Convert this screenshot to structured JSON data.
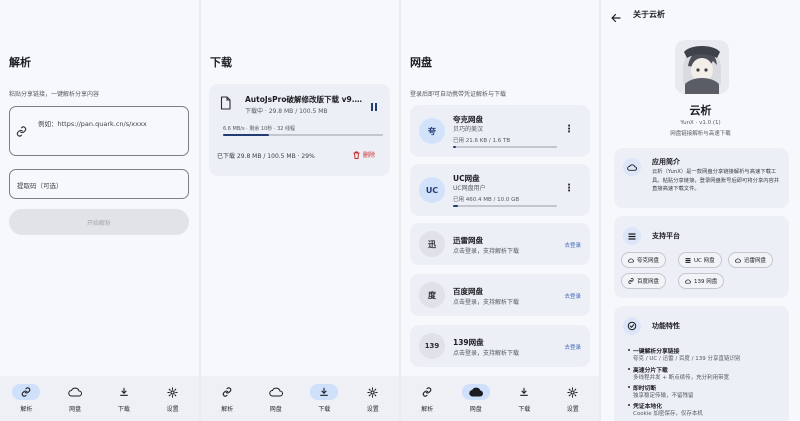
{
  "colors": {
    "accent": "#4269b8",
    "nav_active": "#cfe0fb",
    "delete": "#c62b2b",
    "card": "#eceff6"
  },
  "nav": {
    "items": [
      {
        "label": "解析",
        "icon": "link-icon"
      },
      {
        "label": "网盘",
        "icon": "cloud-icon"
      },
      {
        "label": "下载",
        "icon": "download-icon"
      },
      {
        "label": "设置",
        "icon": "gear-icon"
      }
    ]
  },
  "parse": {
    "title": "解析",
    "hint": "粘贴分享链接，一键解析分享内容",
    "link_placeholder": "例如：https://pan.quark.cn/s/xxxx",
    "code_placeholder": "提取码（可选）",
    "start_button": "开始解析"
  },
  "download": {
    "title": "下载",
    "task": {
      "name": "AutoJsPro破解修改版下载 v9.…",
      "status": "下载中 · 29.8 MB / 100.5 MB",
      "speed": "6.6 MB/s · 剩余 10秒 · 32 线程",
      "progress": 0.29,
      "downloaded": "已下载 29.8 MB / 100.5 MB · 29%",
      "delete_label": "删除"
    }
  },
  "cloud": {
    "title": "网盘",
    "hint": "登录后即可自动携带凭证解析与下载",
    "disks": [
      {
        "avatar": "夸",
        "name": "夸克网盘",
        "user": "贝巧的美汉",
        "usage": "已用 21.6 KB / 1.6 TB",
        "usage_fraction": 0.02,
        "logged_in": true
      },
      {
        "avatar": "UC",
        "name": "UC网盘",
        "user": "UC网盘用户",
        "usage": "已用 460.4 MB / 10.0 GB",
        "usage_fraction": 0.05,
        "logged_in": true
      },
      {
        "avatar": "迅",
        "name": "迅雷网盘",
        "user": "点击登录，支持解析下载",
        "login": "去登录",
        "logged_in": false
      },
      {
        "avatar": "度",
        "name": "百度网盘",
        "user": "点击登录，支持解析下载",
        "login": "去登录",
        "logged_in": false
      },
      {
        "avatar": "139",
        "name": "139网盘",
        "user": "点击登录，支持解析下载",
        "login": "去登录",
        "logged_in": false
      }
    ]
  },
  "about": {
    "title": "关于云析",
    "app_name": "云析",
    "version": "YunX · v1.0 (1)",
    "tagline": "网盘链接解析与高速下载",
    "intro_title": "应用简介",
    "intro_text": "云析（YunX）是一款网盘分享链接解析与高速下载工具。粘贴分享链接，登录网盘账号后即可将分享内容并直接高速下载文件。",
    "platforms_title": "支持平台",
    "platforms": [
      {
        "label": "夸克网盘",
        "icon": "cloud-icon"
      },
      {
        "label": "UC 网盘",
        "icon": "list-icon"
      },
      {
        "label": "迅雷网盘",
        "icon": "cloud-icon"
      },
      {
        "label": "百度网盘",
        "icon": "link-icon"
      },
      {
        "label": "139 网盘",
        "icon": "cloud-icon"
      }
    ],
    "features_title": "功能特性",
    "features": [
      {
        "title": "一键解析分享链接",
        "desc": "夸克 / UC / 迅雷 / 百度 / 139 分享直链识别"
      },
      {
        "title": "高速分片下载",
        "desc": "多线程并发 + 断点续传，充分利用带宽"
      },
      {
        "title": "即时切断",
        "desc": "独享稳定传输，不留残留"
      },
      {
        "title": "凭证本地化",
        "desc": "Cookie 加密保存，仅存本机"
      }
    ]
  }
}
